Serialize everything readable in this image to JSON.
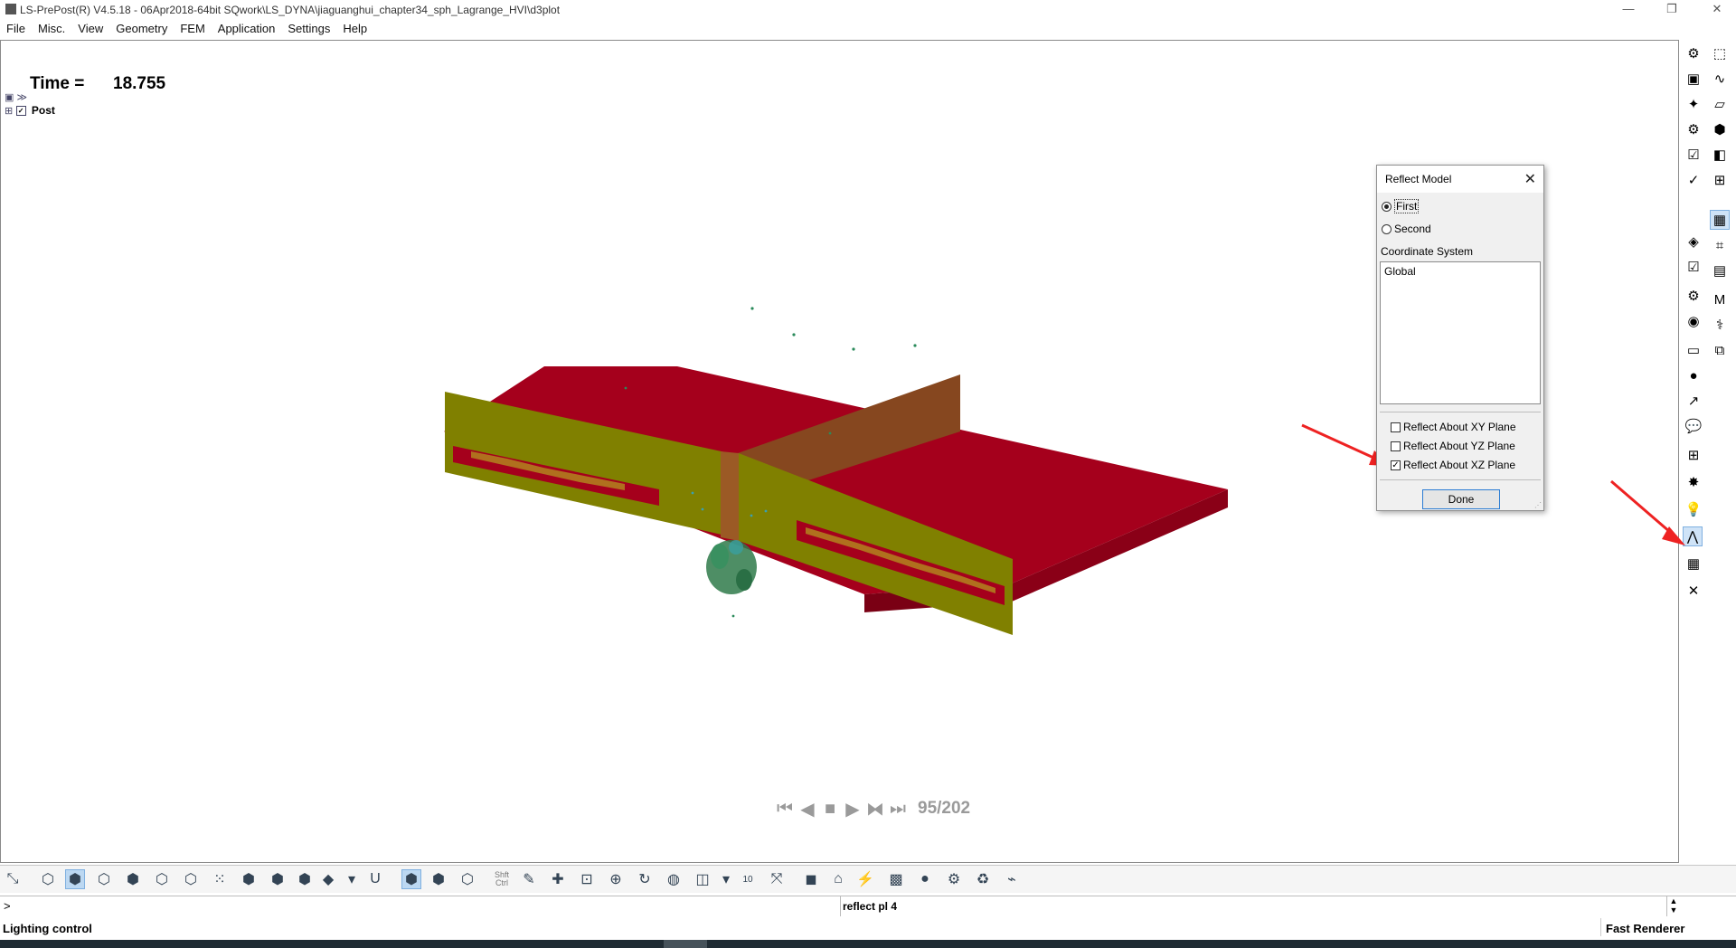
{
  "window": {
    "title": "LS-PrePost(R) V4.5.18 - 06Apr2018-64bit SQwork\\LS_DYNA\\jiaguanghui_chapter34_sph_Lagrange_HVI\\d3plot",
    "minimize": "—",
    "restore": "❐",
    "close": "✕"
  },
  "menu": [
    "File",
    "Misc.",
    "View",
    "Geometry",
    "FEM",
    "Application",
    "Settings",
    "Help"
  ],
  "viewport": {
    "time_label": "Time =",
    "time_value": "18.755",
    "tree_root": "Post",
    "colors": {
      "plate": "#a5001c",
      "wall": "#808000",
      "divider": "#86471f",
      "particles": "#2a8a5a",
      "arrow": "#ee2222"
    }
  },
  "animation": {
    "first": "first-frame-icon",
    "prev": "play-backward-icon",
    "stop": "stop-icon",
    "next": "play-forward-icon",
    "loop": "step-icon",
    "frame_label": "95/202"
  },
  "dialog": {
    "title": "Reflect Model",
    "close": "✕",
    "radio_first": "First",
    "radio_second": "Second",
    "selected_radio": "First",
    "coord_label": "Coordinate System",
    "coord_items": [
      "Global"
    ],
    "checkbox_xy": "Reflect About XY Plane",
    "checkbox_yz": "Reflect About YZ Plane",
    "checkbox_xz": "Reflect About XZ Plane",
    "checked": [
      "Reflect About XZ Plane"
    ],
    "done": "Done"
  },
  "toolbar": {
    "shift_ctrl": "Shft Ctrl",
    "num_label": "10",
    "u_label": "U"
  },
  "command": {
    "prompt": ">",
    "text": "reflect pl 4"
  },
  "status": {
    "left": "Lighting control",
    "right": "Fast Renderer"
  }
}
